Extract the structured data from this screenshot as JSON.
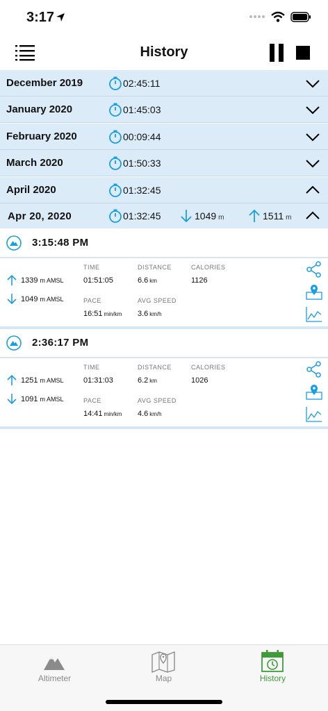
{
  "status_bar": {
    "time": "3:17"
  },
  "nav": {
    "title": "History"
  },
  "months": [
    {
      "label": "December 2019",
      "duration": "02:45:11",
      "expanded": false
    },
    {
      "label": "January 2020",
      "duration": "01:45:03",
      "expanded": false
    },
    {
      "label": "February 2020",
      "duration": "00:09:44",
      "expanded": false
    },
    {
      "label": "March 2020",
      "duration": "01:50:33",
      "expanded": false
    },
    {
      "label": "April 2020",
      "duration": "01:32:45",
      "expanded": true
    }
  ],
  "day": {
    "label": "Apr 20, 2020",
    "duration": "01:32:45",
    "descent": "1049",
    "ascent": "1511",
    "unit": "m"
  },
  "labels": {
    "time": "TIME",
    "distance": "DISTANCE",
    "calories": "CALORIES",
    "pace": "PACE",
    "avg_speed": "AVG SPEED",
    "amsl": "m AMSL",
    "km": "km",
    "pace_unit": "min/km",
    "speed_unit": "km/h"
  },
  "sessions": [
    {
      "start": "3:15:48 PM",
      "max_elev": "1339",
      "min_elev": "1049",
      "time": "01:51:05",
      "distance": "6.6",
      "calories": "1126",
      "pace": "16:51",
      "avg_speed": "3.6"
    },
    {
      "start": "2:36:17 PM",
      "max_elev": "1251",
      "min_elev": "1091",
      "time": "01:31:03",
      "distance": "6.2",
      "calories": "1026",
      "pace": "14:41",
      "avg_speed": "4.6"
    }
  ],
  "tabs": [
    {
      "label": "Altimeter",
      "active": false
    },
    {
      "label": "Map",
      "active": false
    },
    {
      "label": "History",
      "active": true
    }
  ],
  "colors": {
    "accent_blue": "#1a9ee2",
    "row_bg": "#dcebf8",
    "active_green": "#3f9a3a",
    "inactive_gray": "#8b8b8b"
  }
}
